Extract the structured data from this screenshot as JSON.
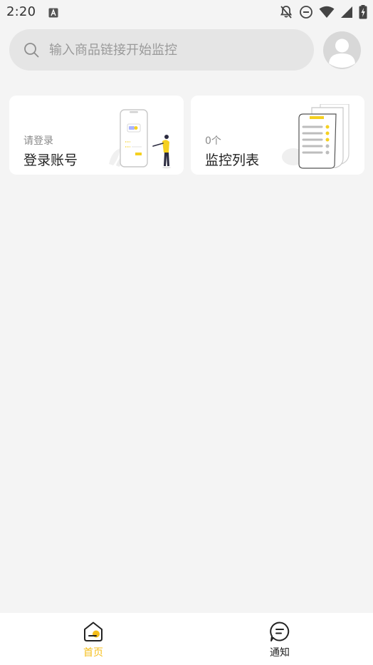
{
  "status_bar": {
    "time": "2:20",
    "icons": [
      "text-a-icon",
      "notifications-off-icon",
      "do-not-disturb-icon",
      "wifi-icon",
      "cellular-signal-icon",
      "battery-charging-icon"
    ]
  },
  "search": {
    "placeholder": "输入商品链接开始监控",
    "value": ""
  },
  "cards": {
    "login": {
      "subtitle": "请登录",
      "title": "登录账号"
    },
    "monitor": {
      "subtitle": "0个",
      "title": "监控列表"
    }
  },
  "bottom_nav": {
    "items": [
      {
        "label": "首页",
        "icon": "home-icon",
        "active": true
      },
      {
        "label": "通知",
        "icon": "message-icon",
        "active": false
      }
    ]
  },
  "colors": {
    "accent": "#f5be1a",
    "background": "#f4f4f4",
    "card": "#ffffff",
    "search_bg": "#e5e5e5",
    "avatar_bg": "#d8d8d8"
  }
}
